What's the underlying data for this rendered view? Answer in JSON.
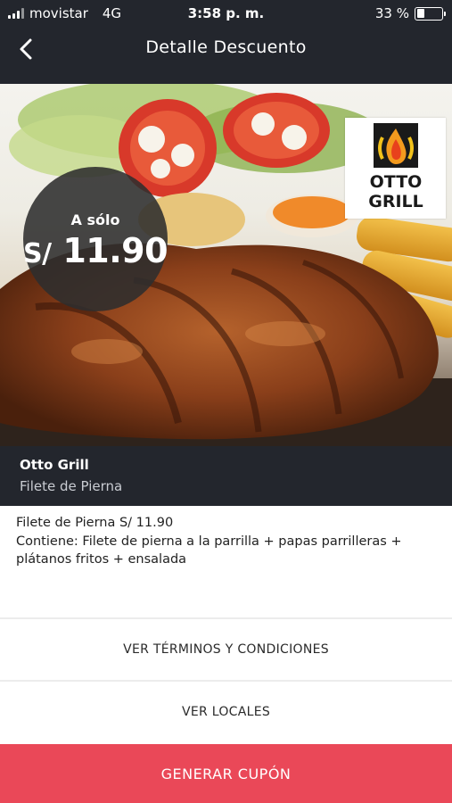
{
  "status_bar": {
    "carrier": "movistar",
    "network": "4G",
    "time": "3:58 p. m.",
    "battery": "33 %",
    "battery_level": 0.33
  },
  "header": {
    "title": "Detalle Descuento",
    "back_icon": "chevron-left-icon"
  },
  "hero": {
    "price_prefix": "A sólo",
    "currency": "S/",
    "price": "11.90",
    "logo_text_top": "OTTO",
    "logo_text_bottom": "GRILL"
  },
  "merchant": {
    "name": "Otto Grill",
    "product": "Filete de Pierna"
  },
  "description": {
    "line1": "Filete de Pierna S/ 11.90",
    "line2": "Contiene: Filete de pierna a la parrilla + papas parrilleras + plátanos fritos + ensalada"
  },
  "actions": {
    "terms": "VER TÉRMINOS Y CONDICIONES",
    "locations": "VER LOCALES",
    "generate": "GENERAR CUPÓN"
  },
  "colors": {
    "dark": "#23262d",
    "accent": "#ea4858"
  }
}
